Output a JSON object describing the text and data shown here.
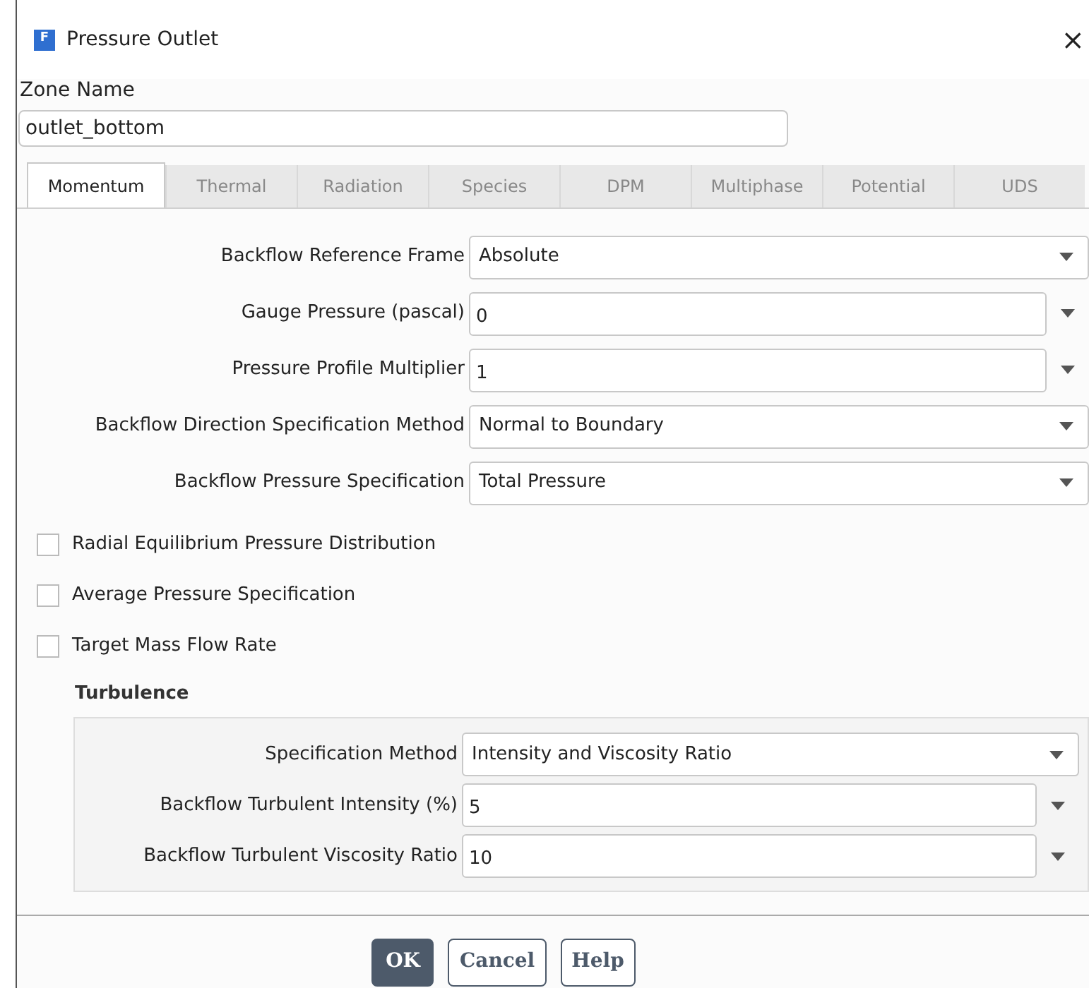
{
  "window": {
    "title": "Pressure Outlet",
    "icon_letter": "F",
    "close": "×"
  },
  "zone": {
    "label": "Zone Name",
    "value": "outlet_bottom"
  },
  "tabs": [
    {
      "label": "Momentum",
      "selected": true
    },
    {
      "label": "Thermal",
      "selected": false
    },
    {
      "label": "Radiation",
      "selected": false
    },
    {
      "label": "Species",
      "selected": false
    },
    {
      "label": "DPM",
      "selected": false
    },
    {
      "label": "Multiphase",
      "selected": false
    },
    {
      "label": "Potential",
      "selected": false
    },
    {
      "label": "UDS",
      "selected": false
    }
  ],
  "fields": [
    {
      "kind": "dropdown",
      "label": "Backflow Reference Frame",
      "value": "Absolute"
    },
    {
      "kind": "number",
      "label": "Gauge Pressure (pascal)",
      "value": "0"
    },
    {
      "kind": "number",
      "label": "Pressure Profile Multiplier",
      "value": "1"
    },
    {
      "kind": "dropdown",
      "label": "Backflow Direction Specification Method",
      "value": "Normal to Boundary"
    },
    {
      "kind": "dropdown",
      "label": "Backflow Pressure Specification",
      "value": "Total Pressure"
    }
  ],
  "checkboxes": [
    {
      "label": "Radial Equilibrium Pressure Distribution",
      "checked": false
    },
    {
      "label": "Average Pressure Specification",
      "checked": false
    },
    {
      "label": "Target Mass Flow Rate",
      "checked": false
    }
  ],
  "turbulence": {
    "title": "Turbulence",
    "fields": [
      {
        "kind": "dropdown",
        "label": "Specification Method",
        "value": "Intensity and Viscosity Ratio"
      },
      {
        "kind": "number",
        "label": "Backflow Turbulent Intensity (%)",
        "value": "5"
      },
      {
        "kind": "number",
        "label": "Backflow Turbulent Viscosity Ratio",
        "value": "10"
      }
    ]
  },
  "buttons": [
    {
      "label": "OK",
      "kind": "primary"
    },
    {
      "label": "Cancel",
      "kind": "secondary"
    },
    {
      "label": "Help",
      "kind": "secondary"
    }
  ]
}
